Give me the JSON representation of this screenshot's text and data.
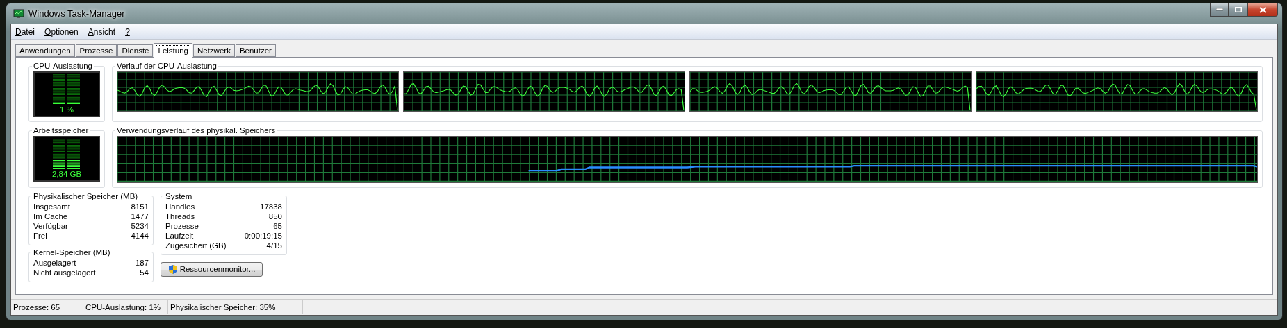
{
  "window": {
    "title": "Windows Task-Manager"
  },
  "menu": [
    {
      "label": "Datei"
    },
    {
      "label": "Optionen"
    },
    {
      "label": "Ansicht"
    },
    {
      "label": "?"
    }
  ],
  "tabs": [
    {
      "label": "Anwendungen",
      "selected": false
    },
    {
      "label": "Prozesse",
      "selected": false
    },
    {
      "label": "Dienste",
      "selected": false
    },
    {
      "label": "Leistung",
      "selected": true
    },
    {
      "label": "Netzwerk",
      "selected": false
    },
    {
      "label": "Benutzer",
      "selected": false
    }
  ],
  "cpu_meter": {
    "title": "CPU-Auslastung",
    "reading": "1 %",
    "level": 0.01
  },
  "cpu_history": {
    "title": "Verlauf der CPU-Auslastung"
  },
  "memory_meter": {
    "title": "Arbeitsspeicher",
    "reading": "2,84 GB",
    "level": 0.35
  },
  "memory_history": {
    "title": "Verwendungsverlauf des physikal. Speichers"
  },
  "physical_memory": {
    "title": "Physikalischer Speicher (MB)",
    "rows": [
      {
        "label": "Insgesamt",
        "value": "8151"
      },
      {
        "label": "Im Cache",
        "value": "1477"
      },
      {
        "label": "Verfügbar",
        "value": "5234"
      },
      {
        "label": "Frei",
        "value": "4144"
      }
    ]
  },
  "kernel_memory": {
    "title": "Kernel-Speicher (MB)",
    "rows": [
      {
        "label": "Ausgelagert",
        "value": "187"
      },
      {
        "label": "Nicht ausgelagert",
        "value": "54"
      }
    ]
  },
  "system": {
    "title": "System",
    "rows": [
      {
        "label": "Handles",
        "value": "17838"
      },
      {
        "label": "Threads",
        "value": "850"
      },
      {
        "label": "Prozesse",
        "value": "65"
      },
      {
        "label": "Laufzeit",
        "value": "0:00:19:15"
      },
      {
        "label": "Zugesichert (GB)",
        "value": "4/15"
      }
    ]
  },
  "resource_button": {
    "label": "Ressourcenmonitor..."
  },
  "status_bar": [
    "Prozesse: 65",
    "CPU-Auslastung: 1%",
    "Physikalischer Speicher: 35%"
  ]
}
